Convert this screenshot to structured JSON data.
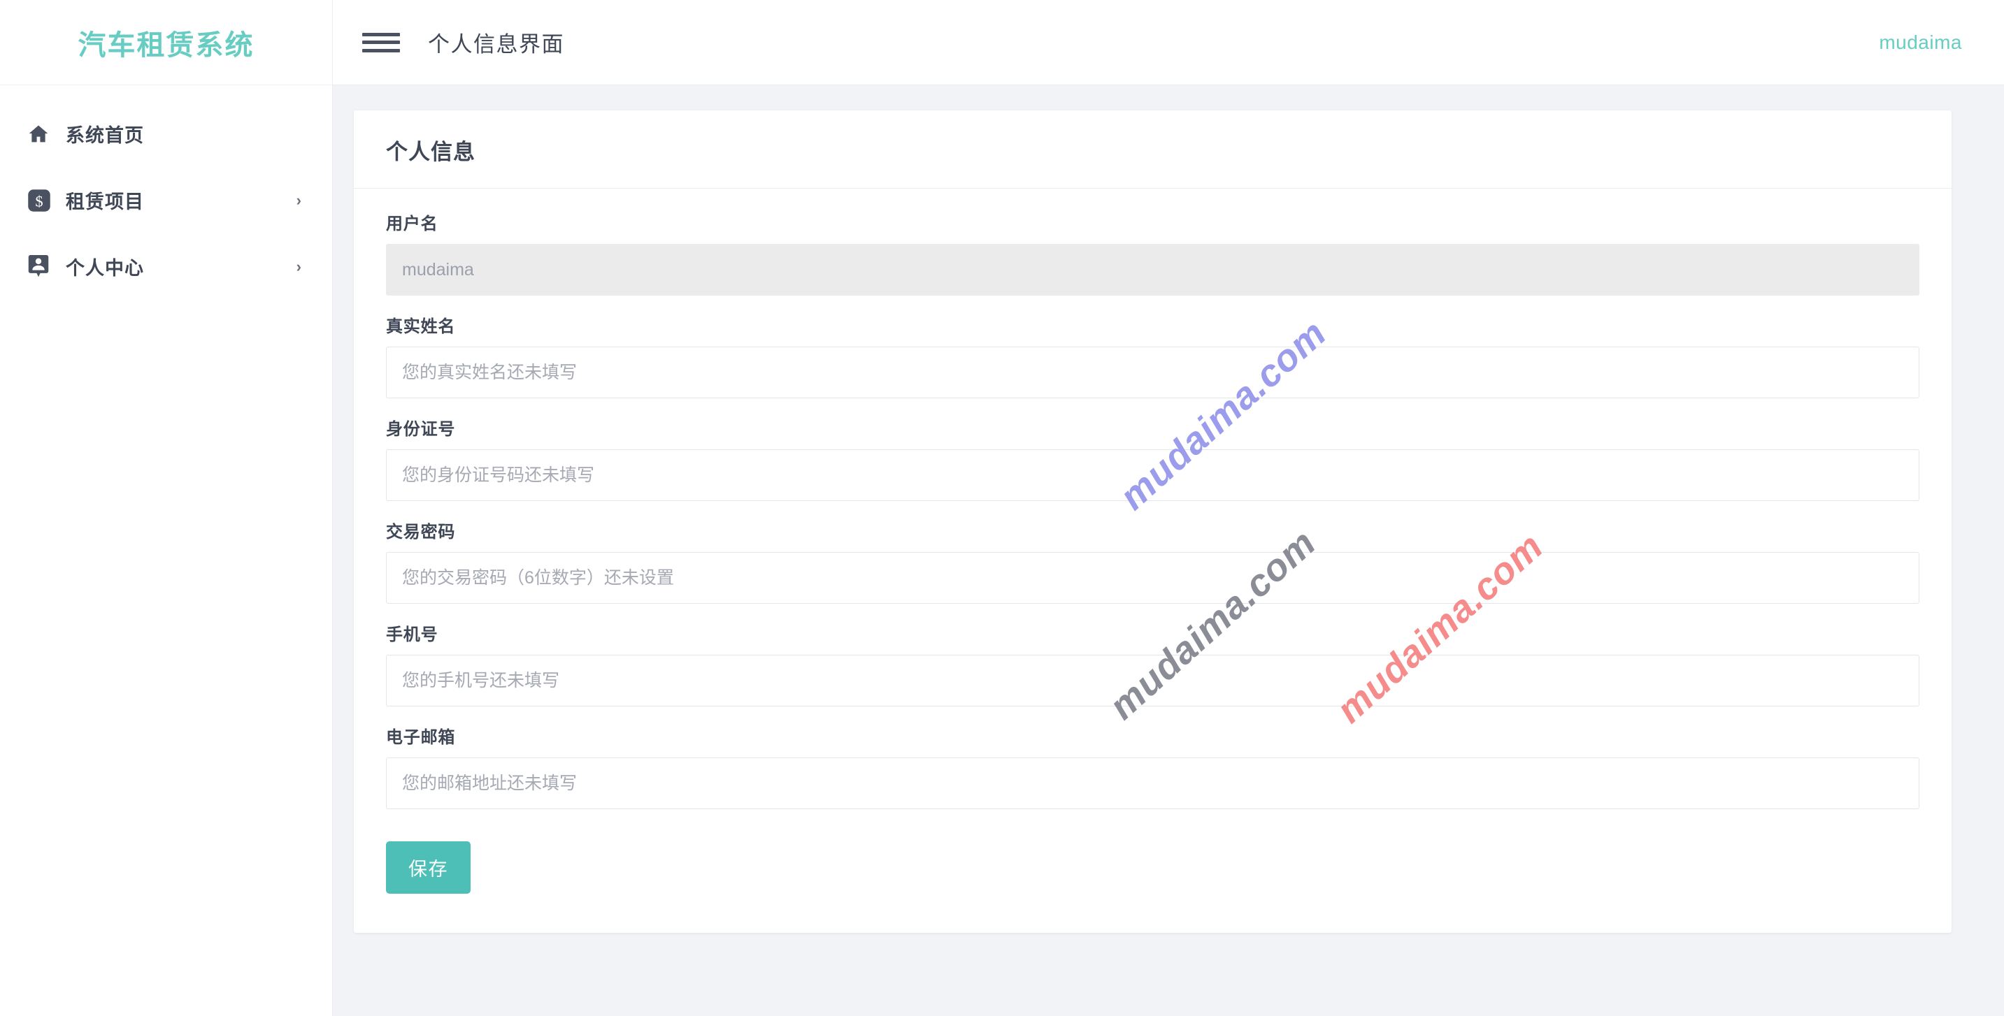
{
  "brand": {
    "title": "汽车租赁系统",
    "color": "#67cdc2"
  },
  "sidebar": {
    "items": [
      {
        "label": "系统首页",
        "icon": "home-icon",
        "has_chevron": false
      },
      {
        "label": "租赁项目",
        "icon": "dollar-badge-icon",
        "has_chevron": true,
        "chevron": "›"
      },
      {
        "label": "个人中心",
        "icon": "user-badge-icon",
        "has_chevron": true,
        "chevron": "›"
      }
    ]
  },
  "topbar": {
    "menu_icon": "hamburger-icon",
    "title": "个人信息界面",
    "user": "mudaima"
  },
  "card": {
    "title": "个人信息",
    "fields": [
      {
        "key": "username",
        "label": "用户名",
        "value": "mudaima",
        "placeholder": "",
        "disabled": true,
        "type": "text"
      },
      {
        "key": "realname",
        "label": "真实姓名",
        "value": "",
        "placeholder": "您的真实姓名还未填写",
        "disabled": false,
        "type": "text"
      },
      {
        "key": "idcard",
        "label": "身份证号",
        "value": "",
        "placeholder": "您的身份证号码还未填写",
        "disabled": false,
        "type": "text"
      },
      {
        "key": "paypassword",
        "label": "交易密码",
        "value": "",
        "placeholder": "您的交易密码（6位数字）还未设置",
        "disabled": false,
        "type": "password"
      },
      {
        "key": "phone",
        "label": "手机号",
        "value": "",
        "placeholder": "您的手机号还未填写",
        "disabled": false,
        "type": "text"
      },
      {
        "key": "email",
        "label": "电子邮箱",
        "value": "",
        "placeholder": "您的邮箱地址还未填写",
        "disabled": false,
        "type": "text"
      }
    ],
    "save_label": "保存",
    "save_color": "#4dbfb6"
  },
  "watermarks": [
    {
      "text": "mudaima.com",
      "color": "#9b9ceb"
    },
    {
      "text": "mudaima.com",
      "color": "#8a8d95"
    },
    {
      "text": "mudaima.com",
      "color": "#f58b8b"
    }
  ]
}
